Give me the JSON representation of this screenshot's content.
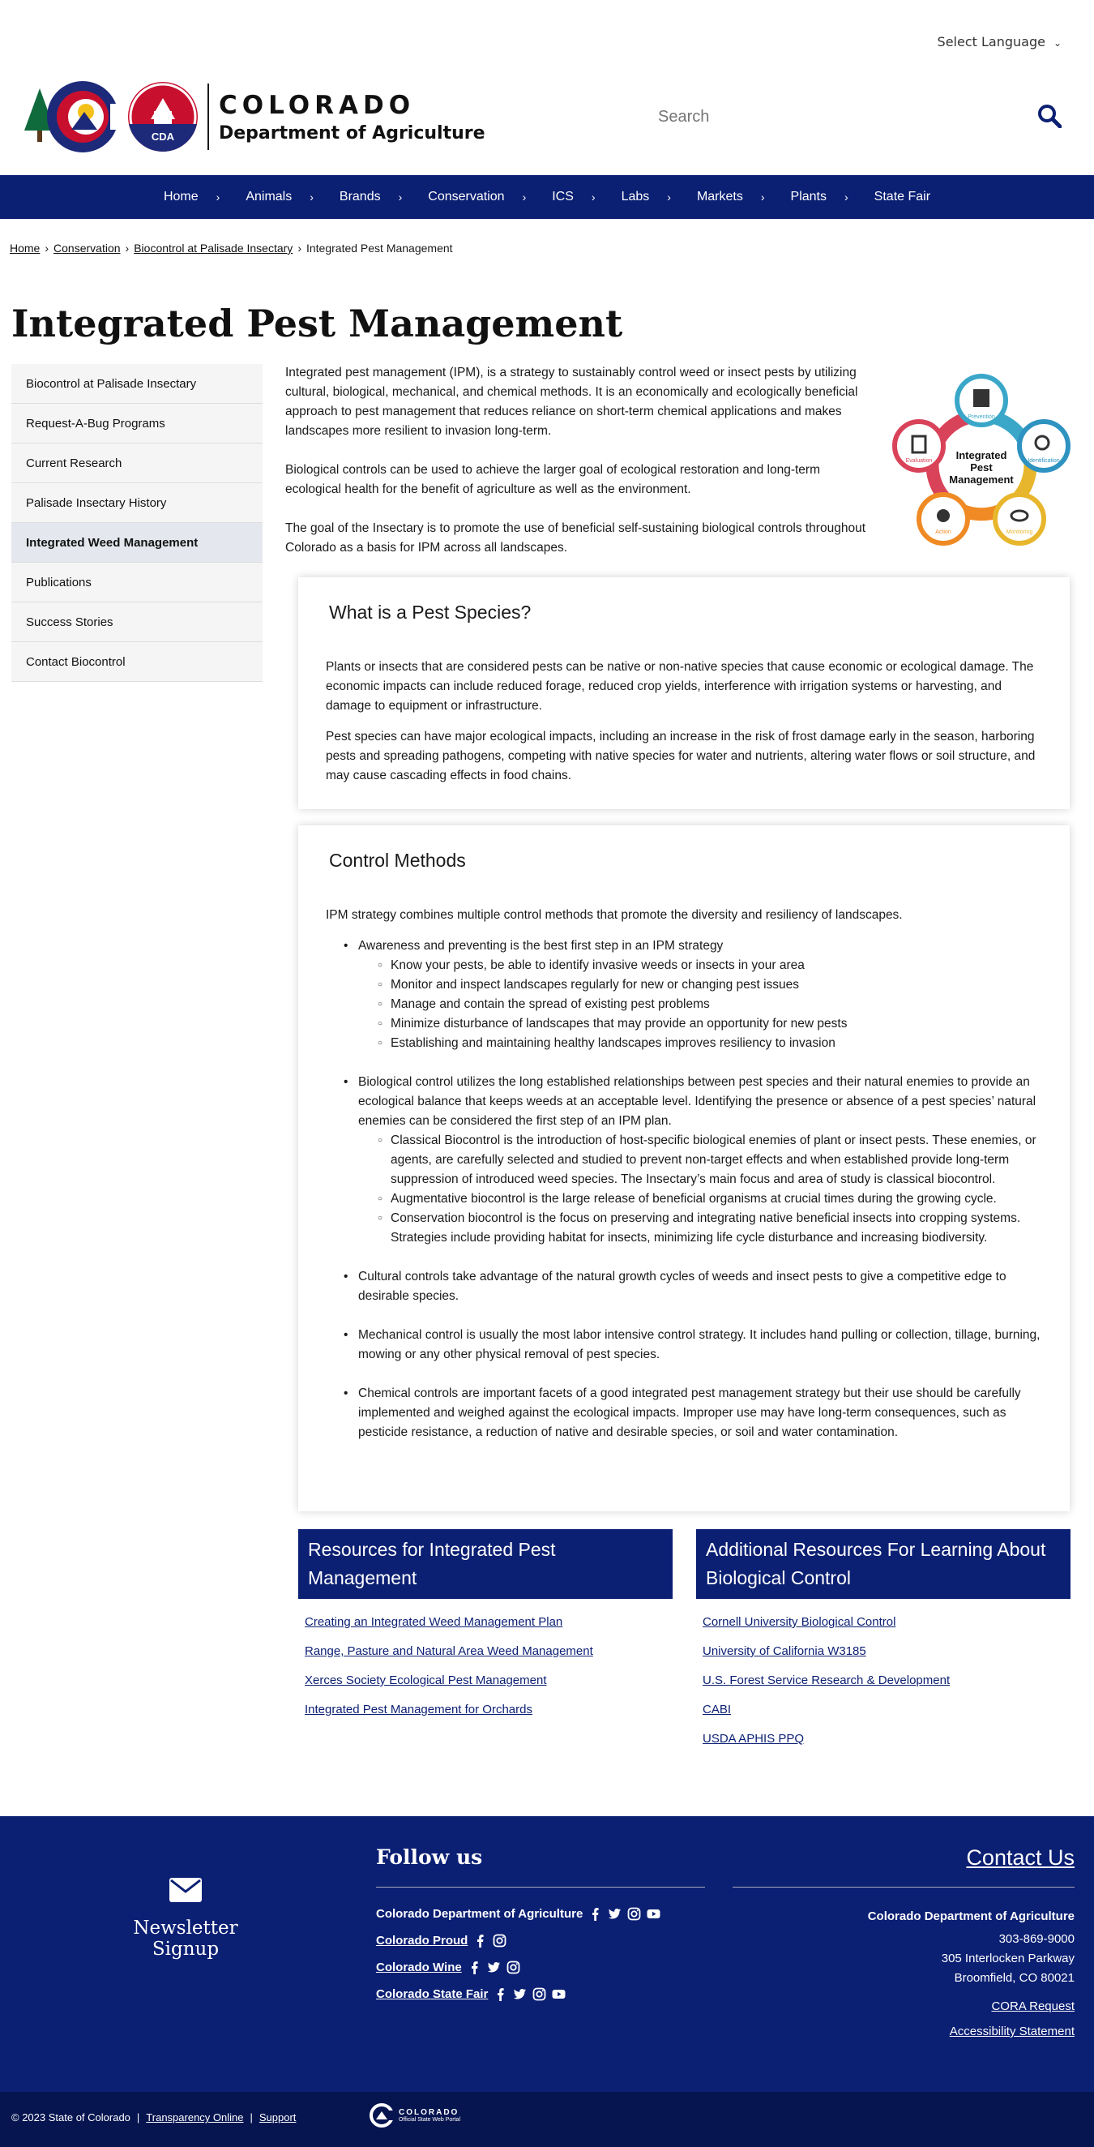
{
  "header": {
    "language_label": "Select Language",
    "logo_state": "COLORADO",
    "logo_dept": "Department of Agriculture",
    "logo_badge": "CDA",
    "search_placeholder": "Search"
  },
  "nav": {
    "items": [
      "Home",
      "Animals",
      "Brands",
      "Conservation",
      "ICS",
      "Labs",
      "Markets",
      "Plants",
      "State Fair"
    ]
  },
  "breadcrumb": {
    "items": [
      "Home",
      "Conservation",
      "Biocontrol at Palisade Insectary"
    ],
    "current": "Integrated Pest Management"
  },
  "page_title": "Integrated Pest Management",
  "sidebar": {
    "items": [
      "Biocontrol at Palisade Insectary",
      "Request-A-Bug Programs",
      "Current Research",
      "Palisade Insectary History",
      "Integrated Weed Management",
      "Publications",
      "Success Stories",
      "Contact Biocontrol"
    ],
    "active_index": 4
  },
  "intro": {
    "p1": "Integrated pest management (IPM), is a strategy to sustainably control weed or insect pests by utilizing cultural, biological, mechanical, and chemical methods. It is an economically and ecologically beneficial approach to pest management that reduces reliance on short-term chemical applications and makes landscapes more resilient to invasion long-term.",
    "p2": "Biological controls can be used to achieve the larger goal of ecological restoration and long-term ecological health for the benefit of agriculture as well as the environment.",
    "p3": "The goal of the Insectary is to promote the use of beneficial self-sustaining biological controls throughout Colorado as a basis for IPM across all landscapes."
  },
  "ipm_graphic": {
    "center_line1": "Integrated",
    "center_line2": "Pest",
    "center_line3": "Management",
    "nodes": [
      "Prevention",
      "Identification",
      "Monitoring",
      "Action",
      "Evaluation"
    ],
    "colors": [
      "#3aa7c9",
      "#2e93c0",
      "#e8b62c",
      "#f08a24",
      "#d9435a"
    ]
  },
  "pest_species": {
    "title": "What is a Pest Species?",
    "p1": "Plants or insects that are considered pests can be native or non-native species that cause economic or ecological damage. The economic impacts can include reduced forage, reduced crop yields, interference with irrigation systems or harvesting, and damage to equipment or infrastructure.",
    "p2": "Pest species can have major ecological impacts, including an increase in the risk of frost damage early in the season, harboring pests and spreading pathogens, competing with native species for water and nutrients, altering water flows or soil structure, and may cause cascading effects in food chains."
  },
  "control_methods": {
    "title": "Control Methods",
    "intro": "IPM strategy combines multiple control methods that promote the diversity and resiliency of landscapes.",
    "awareness": "Awareness and preventing is the best first step in an IPM strategy",
    "awareness_sub": [
      "Know your pests, be able to identify invasive weeds or insects in your area",
      "Monitor and inspect landscapes regularly for new or changing pest issues",
      "Manage and contain the spread of existing pest problems",
      "Minimize disturbance of landscapes that may provide an opportunity for new pests",
      "Establishing and maintaining healthy landscapes improves resiliency to invasion"
    ],
    "biological": "Biological control utilizes the long established relationships between pest species and their natural enemies to provide an ecological balance that keeps weeds at an acceptable level. Identifying the presence or absence of a pest species’ natural enemies can be considered the first step of an IPM plan.",
    "biological_sub": [
      "Classical Biocontrol is the introduction of host-specific biological enemies of plant or insect pests. These enemies, or agents, are carefully selected and studied to prevent non-target effects and when established provide long-term suppression of introduced weed species. The Insectary’s main focus and area of study is classical biocontrol.",
      "Augmentative biocontrol is the large release of beneficial organisms at crucial times during the growing cycle.",
      "Conservation biocontrol is the focus on preserving and integrating native beneficial insects into cropping systems. Strategies include providing habitat for insects, minimizing life cycle disturbance and increasing biodiversity."
    ],
    "cultural": "Cultural controls take advantage of the natural growth cycles of weeds and insect pests to give a competitive edge to desirable species.",
    "mechanical": "Mechanical control is usually the most labor intensive control strategy. It includes hand pulling or collection, tillage, burning, mowing or any other physical removal of pest species.",
    "chemical": "Chemical controls are important facets of a good integrated pest management strategy but their use should be carefully implemented and weighed against the ecological impacts. Improper use may have long-term consequences, such as pesticide resistance, a reduction of native and desirable species, or soil and water contamination."
  },
  "resources_ipm": {
    "title": "Resources for Integrated Pest Management",
    "links": [
      "Creating an Integrated Weed Management Plan",
      "Range, Pasture and Natural Area Weed Management",
      "Xerces Society Ecological Pest Management",
      "Integrated Pest Management for Orchards"
    ]
  },
  "resources_bio": {
    "title": "Additional Resources For Learning About Biological Control",
    "links": [
      "Cornell University Biological Control",
      "University of California W3185",
      "U.S. Forest Service Research & Development",
      "CABI",
      "USDA APHIS PPQ"
    ]
  },
  "footer": {
    "newsletter": "Newsletter Signup",
    "follow_title": "Follow us",
    "follow_rows": [
      "Colorado Department of Agriculture",
      "Colorado Proud",
      "Colorado Wine",
      "Colorado State Fair"
    ],
    "contact_title": "Contact Us",
    "contact_org": "Colorado Department of Agriculture",
    "contact_phone": "303-869-9000",
    "contact_addr1": "305 Interlocken Parkway",
    "contact_addr2": "Broomfield, CO 80021",
    "cora": "CORA Request",
    "accessibility": "Accessibility Statement",
    "copyright": "© 2023 State of Colorado",
    "transparency": "Transparency Online",
    "support": "Support",
    "official_state": "COLORADO",
    "official_sub": "Official State Web Portal"
  }
}
